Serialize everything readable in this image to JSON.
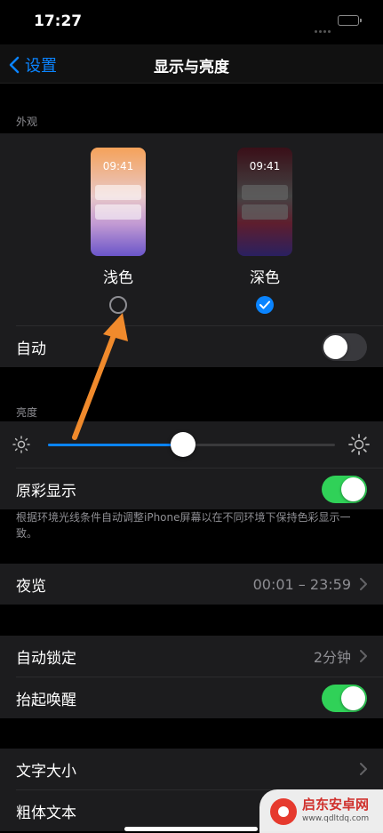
{
  "status": {
    "time": "17:27"
  },
  "nav": {
    "back_label": "设置",
    "title": "显示与亮度"
  },
  "appearance": {
    "section_label": "外观",
    "light": {
      "label": "浅色",
      "preview_time": "09:41",
      "selected": false
    },
    "dark": {
      "label": "深色",
      "preview_time": "09:41",
      "selected": true
    },
    "auto_label": "自动",
    "auto_on": false
  },
  "brightness": {
    "section_label": "亮度",
    "level": 0.47,
    "true_tone_label": "原彩显示",
    "true_tone_on": true,
    "footnote": "根据环境光线条件自动调整iPhone屏幕以在不同环境下保持色彩显示一致。"
  },
  "night_shift": {
    "label": "夜览",
    "value": "00:01 – 23:59"
  },
  "lock": {
    "auto_lock_label": "自动锁定",
    "auto_lock_value": "2分钟",
    "raise_to_wake_label": "抬起唤醒",
    "raise_to_wake_on": true
  },
  "text": {
    "text_size_label": "文字大小",
    "bold_text_label": "粗体文本"
  },
  "watermark": {
    "name": "启东安卓网",
    "url": "www.qdltdq.com"
  },
  "colors": {
    "accent": "#0a84ff",
    "toggle_on": "#30d158",
    "annotation_arrow": "#f08a2c"
  }
}
